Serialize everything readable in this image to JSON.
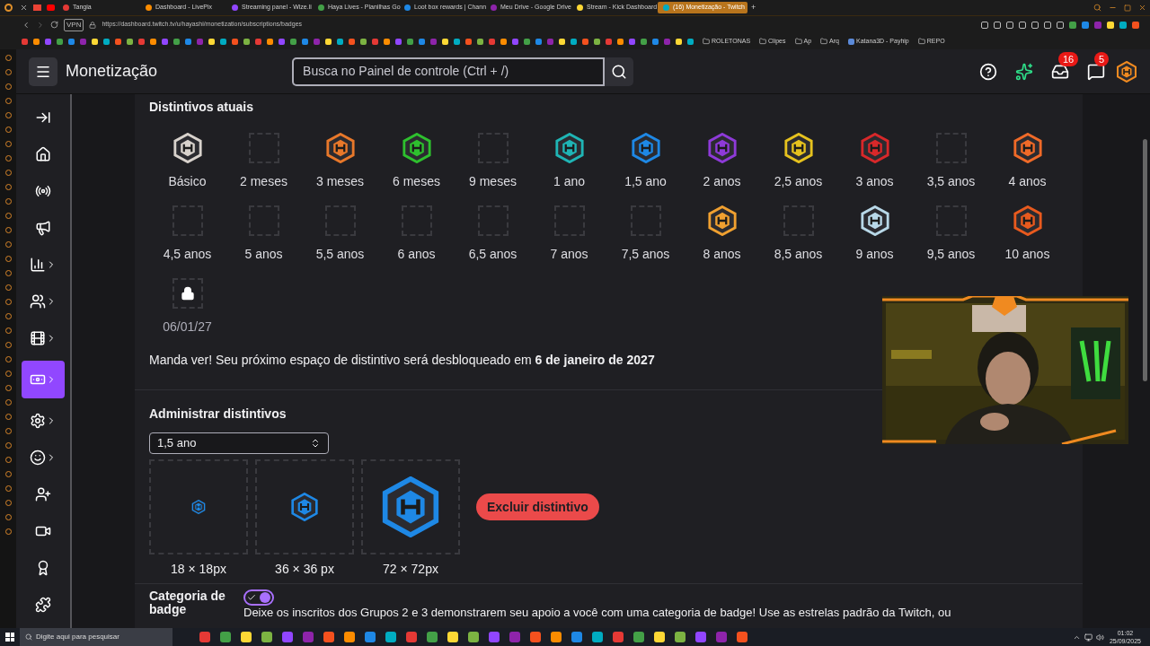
{
  "browser": {
    "tabs": [
      {
        "title": "Tangia",
        "selected": false
      },
      {
        "title": "Dashboard - LivePix",
        "selected": false
      },
      {
        "title": "Streaming panel - Wize.li",
        "selected": false
      },
      {
        "title": "Haya Lives - Planilhas Go",
        "selected": false
      },
      {
        "title": "Loot box rewards | Chann",
        "selected": false
      },
      {
        "title": "Meu Drive - Google Drive",
        "selected": false
      },
      {
        "title": "Stream - Kick Dashboard",
        "selected": false
      },
      {
        "title": "(16) Monetização - Twitch",
        "selected": true
      }
    ],
    "new_tab": "+",
    "vpn": "VPN",
    "url": "https://dashboard.twitch.tv/u/hayashi/monetization/subscriptions/badges",
    "bookmarks": [
      {
        "kind": "folder",
        "label": "ROLETONAS"
      },
      {
        "kind": "folder",
        "label": "Clipes"
      },
      {
        "kind": "folder",
        "label": "Ap"
      },
      {
        "kind": "folder",
        "label": "Arq"
      },
      {
        "kind": "link",
        "label": "Katana3D - Payhip"
      },
      {
        "kind": "folder",
        "label": "REPO"
      }
    ]
  },
  "header": {
    "title": "Monetização",
    "search_placeholder": "Busca no Painel de controle (Ctrl + /)",
    "inbox_count": "16",
    "chat_count": "5"
  },
  "sidebar": {
    "items": [
      {
        "expandable": false,
        "selected": false
      },
      {
        "expandable": false,
        "selected": false
      },
      {
        "expandable": false,
        "selected": false
      },
      {
        "expandable": false,
        "selected": false
      },
      {
        "expandable": true,
        "selected": false
      },
      {
        "expandable": true,
        "selected": false
      },
      {
        "expandable": true,
        "selected": false
      },
      {
        "expandable": true,
        "selected": true
      },
      {
        "expandable": true,
        "selected": false
      },
      {
        "expandable": true,
        "selected": false
      },
      {
        "expandable": false,
        "selected": false
      },
      {
        "expandable": false,
        "selected": false
      },
      {
        "expandable": false,
        "selected": false
      },
      {
        "expandable": false,
        "selected": false
      }
    ]
  },
  "current_badges": {
    "title": "Distintivos atuais",
    "badges": [
      {
        "label": "Básico",
        "kind": "badge",
        "color": "#d8d2cc"
      },
      {
        "label": "2 meses",
        "kind": "empty"
      },
      {
        "label": "3 meses",
        "kind": "badge",
        "color": "#e8782a"
      },
      {
        "label": "6 meses",
        "kind": "badge",
        "color": "#2ec02e"
      },
      {
        "label": "9 meses",
        "kind": "empty"
      },
      {
        "label": "1 ano",
        "kind": "badge",
        "color": "#1fb5b5"
      },
      {
        "label": "1,5 ano",
        "kind": "badge",
        "color": "#1e88e5"
      },
      {
        "label": "2 anos",
        "kind": "badge",
        "color": "#8e3ad8"
      },
      {
        "label": "2,5 anos",
        "kind": "badge",
        "color": "#e6c21e"
      },
      {
        "label": "3 anos",
        "kind": "badge",
        "color": "#d8282a"
      },
      {
        "label": "3,5 anos",
        "kind": "empty"
      },
      {
        "label": "4 anos",
        "kind": "badge",
        "color": "#f06a28"
      },
      {
        "label": "4,5 anos",
        "kind": "empty"
      },
      {
        "label": "5 anos",
        "kind": "empty"
      },
      {
        "label": "5,5 anos",
        "kind": "empty"
      },
      {
        "label": "6 anos",
        "kind": "empty"
      },
      {
        "label": "6,5 anos",
        "kind": "empty"
      },
      {
        "label": "7 anos",
        "kind": "empty"
      },
      {
        "label": "7,5 anos",
        "kind": "empty"
      },
      {
        "label": "8 anos",
        "kind": "badge",
        "color": "#f0a030"
      },
      {
        "label": "8,5 anos",
        "kind": "empty"
      },
      {
        "label": "9 anos",
        "kind": "badge",
        "color": "#b8d8e8"
      },
      {
        "label": "9,5 anos",
        "kind": "empty"
      },
      {
        "label": "10 anos",
        "kind": "badge",
        "color": "#e85a1e"
      },
      {
        "label": "06/01/27",
        "kind": "locked"
      }
    ],
    "unlock_message": "Manda ver! Seu próximo espaço de distintivo será desbloqueado em **6 de janeiro de 2027**"
  },
  "manage": {
    "title": "Administrar distintivos",
    "select_value": "1,5 ano",
    "color": "#1e88e5",
    "previews": [
      "18 × 18px",
      "36 × 36 px",
      "72 × 72px"
    ],
    "delete_button": "Excluir distintivo"
  },
  "category": {
    "title": "Categoria de badge",
    "on": true,
    "description": "Deixe os inscritos dos Grupos 2 e 3 demonstrarem seu apoio a você com uma categoria de badge! Use as estrelas padrão da Twitch, ou"
  },
  "taskbar": {
    "search_placeholder": "Digite aqui para pesquisar",
    "time": "01:02",
    "date": "25/09/2025"
  }
}
